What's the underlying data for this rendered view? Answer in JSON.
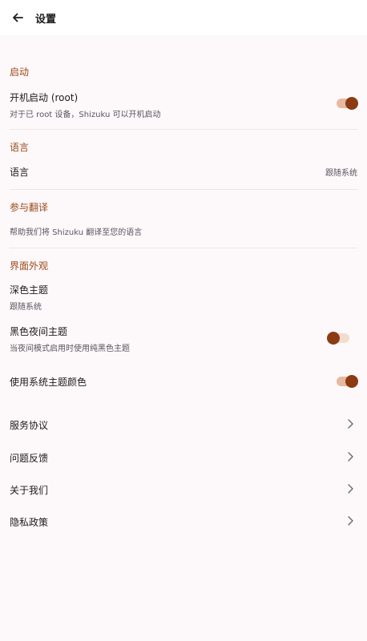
{
  "header": {
    "title": "设置"
  },
  "sections": {
    "startup": {
      "title": "启动",
      "boot": {
        "title": "开机启动 (root)",
        "subtitle": "对于已 root 设备，Shizuku 可以开机启动",
        "enabled": true
      }
    },
    "language": {
      "title": "语言",
      "row": {
        "title": "语言",
        "value": "跟随系统"
      }
    },
    "translation": {
      "title": "参与翻译",
      "row": {
        "subtitle": "帮助我们将 Shizuku 翻译至您的语言"
      }
    },
    "appearance": {
      "title": "界面外观",
      "dark_theme": {
        "title": "深色主题",
        "subtitle": "跟随系统"
      },
      "black_night": {
        "title": "黑色夜间主题",
        "subtitle": "当夜间模式启用时使用纯黑色主题",
        "enabled": false
      },
      "system_color": {
        "title": "使用系统主题颜色",
        "enabled": true
      }
    }
  },
  "links": [
    {
      "label": "服务协议"
    },
    {
      "label": "问题反馈"
    },
    {
      "label": "关于我们"
    },
    {
      "label": "隐私政策"
    }
  ],
  "colors": {
    "accent": "#9c4a1a",
    "knob": "#8b3b12",
    "track_on": "#e7b9a0",
    "track_off": "#f3dccf"
  }
}
